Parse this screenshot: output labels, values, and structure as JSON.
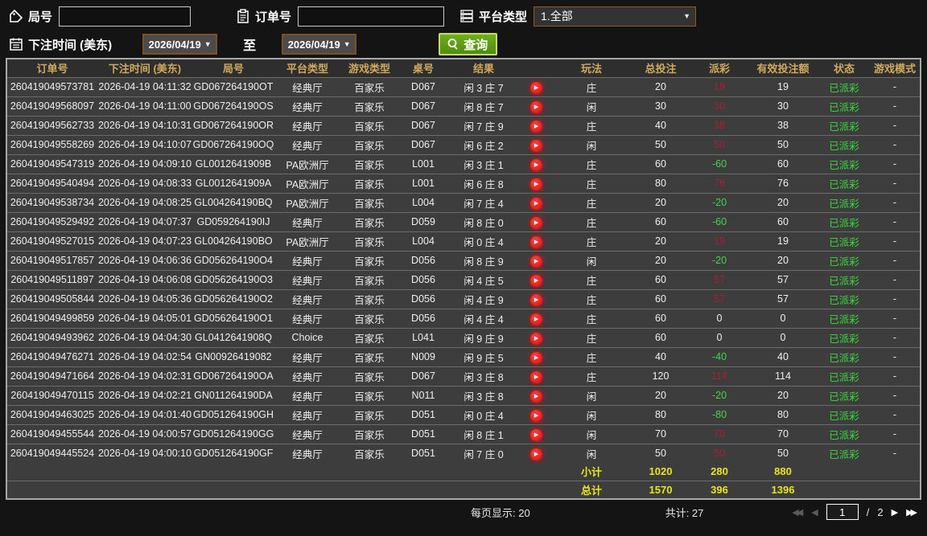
{
  "filters": {
    "game_no_label": "局号",
    "order_no_label": "订单号",
    "platform_label": "平台类型",
    "platform_value": "1.全部",
    "bet_time_label": "下注时间 (美东)",
    "date_from": "2026/04/19",
    "date_to": "2026/04/19",
    "to_label": "至",
    "query_label": "查询",
    "game_no_value": "",
    "order_no_value": ""
  },
  "icons": {
    "dropdown_arrow": "▼",
    "play": "▶",
    "page_first": "◀◀",
    "page_prev": "◀",
    "page_next": "▶",
    "page_last": "▶▶"
  },
  "table": {
    "columns": [
      "订单号",
      "下注时间 (美东)",
      "局号",
      "平台类型",
      "游戏类型",
      "桌号",
      "结果",
      "",
      "玩法",
      "总投注",
      "派彩",
      "有效投注额",
      "状态",
      "游戏模式"
    ],
    "rows": [
      {
        "order": "260419049573781",
        "time": "2026-04-19 04:11:32",
        "round": "GD067264190OT",
        "hall": "经典厅",
        "game": "百家乐",
        "table": "D067",
        "result": "闲 3 庄 7",
        "bet": "庄",
        "stake": "20",
        "payout": "19",
        "valid": "19",
        "status": "已派彩",
        "mode": "-"
      },
      {
        "order": "260419049568097",
        "time": "2026-04-19 04:11:00",
        "round": "GD067264190OS",
        "hall": "经典厅",
        "game": "百家乐",
        "table": "D067",
        "result": "闲 8 庄 7",
        "bet": "闲",
        "stake": "30",
        "payout": "30",
        "valid": "30",
        "status": "已派彩",
        "mode": "-"
      },
      {
        "order": "260419049562733",
        "time": "2026-04-19 04:10:31",
        "round": "GD067264190OR",
        "hall": "经典厅",
        "game": "百家乐",
        "table": "D067",
        "result": "闲 7 庄 9",
        "bet": "庄",
        "stake": "40",
        "payout": "38",
        "valid": "38",
        "status": "已派彩",
        "mode": "-"
      },
      {
        "order": "260419049558269",
        "time": "2026-04-19 04:10:07",
        "round": "GD067264190OQ",
        "hall": "经典厅",
        "game": "百家乐",
        "table": "D067",
        "result": "闲 6 庄 2",
        "bet": "闲",
        "stake": "50",
        "payout": "50",
        "valid": "50",
        "status": "已派彩",
        "mode": "-"
      },
      {
        "order": "260419049547319",
        "time": "2026-04-19 04:09:10",
        "round": "GL0012641909B",
        "hall": "PA欧洲厅",
        "game": "百家乐",
        "table": "L001",
        "result": "闲 3 庄 1",
        "bet": "庄",
        "stake": "60",
        "payout": "-60",
        "valid": "60",
        "status": "已派彩",
        "mode": "-"
      },
      {
        "order": "260419049540494",
        "time": "2026-04-19 04:08:33",
        "round": "GL0012641909A",
        "hall": "PA欧洲厅",
        "game": "百家乐",
        "table": "L001",
        "result": "闲 6 庄 8",
        "bet": "庄",
        "stake": "80",
        "payout": "76",
        "valid": "76",
        "status": "已派彩",
        "mode": "-"
      },
      {
        "order": "260419049538734",
        "time": "2026-04-19 04:08:25",
        "round": "GL004264190BQ",
        "hall": "PA欧洲厅",
        "game": "百家乐",
        "table": "L004",
        "result": "闲 7 庄 4",
        "bet": "庄",
        "stake": "20",
        "payout": "-20",
        "valid": "20",
        "status": "已派彩",
        "mode": "-"
      },
      {
        "order": "260419049529492",
        "time": "2026-04-19 04:07:37",
        "round": "GD059264190IJ",
        "hall": "经典厅",
        "game": "百家乐",
        "table": "D059",
        "result": "闲 8 庄 0",
        "bet": "庄",
        "stake": "60",
        "payout": "-60",
        "valid": "60",
        "status": "已派彩",
        "mode": "-"
      },
      {
        "order": "260419049527015",
        "time": "2026-04-19 04:07:23",
        "round": "GL004264190BO",
        "hall": "PA欧洲厅",
        "game": "百家乐",
        "table": "L004",
        "result": "闲 0 庄 4",
        "bet": "庄",
        "stake": "20",
        "payout": "19",
        "valid": "19",
        "status": "已派彩",
        "mode": "-"
      },
      {
        "order": "260419049517857",
        "time": "2026-04-19 04:06:36",
        "round": "GD056264190O4",
        "hall": "经典厅",
        "game": "百家乐",
        "table": "D056",
        "result": "闲 8 庄 9",
        "bet": "闲",
        "stake": "20",
        "payout": "-20",
        "valid": "20",
        "status": "已派彩",
        "mode": "-"
      },
      {
        "order": "260419049511897",
        "time": "2026-04-19 04:06:08",
        "round": "GD056264190O3",
        "hall": "经典厅",
        "game": "百家乐",
        "table": "D056",
        "result": "闲 4 庄 5",
        "bet": "庄",
        "stake": "60",
        "payout": "57",
        "valid": "57",
        "status": "已派彩",
        "mode": "-"
      },
      {
        "order": "260419049505844",
        "time": "2026-04-19 04:05:36",
        "round": "GD056264190O2",
        "hall": "经典厅",
        "game": "百家乐",
        "table": "D056",
        "result": "闲 4 庄 9",
        "bet": "庄",
        "stake": "60",
        "payout": "57",
        "valid": "57",
        "status": "已派彩",
        "mode": "-"
      },
      {
        "order": "260419049499859",
        "time": "2026-04-19 04:05:01",
        "round": "GD056264190O1",
        "hall": "经典厅",
        "game": "百家乐",
        "table": "D056",
        "result": "闲 4 庄 4",
        "bet": "庄",
        "stake": "60",
        "payout": "0",
        "valid": "0",
        "status": "已派彩",
        "mode": "-"
      },
      {
        "order": "260419049493962",
        "time": "2026-04-19 04:04:30",
        "round": "GL0412641908Q",
        "hall": "Choice",
        "game": "百家乐",
        "table": "L041",
        "result": "闲 9 庄 9",
        "bet": "庄",
        "stake": "60",
        "payout": "0",
        "valid": "0",
        "status": "已派彩",
        "mode": "-"
      },
      {
        "order": "260419049476271",
        "time": "2026-04-19 04:02:54",
        "round": "GN00926419082",
        "hall": "经典厅",
        "game": "百家乐",
        "table": "N009",
        "result": "闲 9 庄 5",
        "bet": "庄",
        "stake": "40",
        "payout": "-40",
        "valid": "40",
        "status": "已派彩",
        "mode": "-"
      },
      {
        "order": "260419049471664",
        "time": "2026-04-19 04:02:31",
        "round": "GD067264190OA",
        "hall": "经典厅",
        "game": "百家乐",
        "table": "D067",
        "result": "闲 3 庄 8",
        "bet": "庄",
        "stake": "120",
        "payout": "114",
        "valid": "114",
        "status": "已派彩",
        "mode": "-"
      },
      {
        "order": "260419049470115",
        "time": "2026-04-19 04:02:21",
        "round": "GN011264190DA",
        "hall": "经典厅",
        "game": "百家乐",
        "table": "N011",
        "result": "闲 3 庄 8",
        "bet": "闲",
        "stake": "20",
        "payout": "-20",
        "valid": "20",
        "status": "已派彩",
        "mode": "-"
      },
      {
        "order": "260419049463025",
        "time": "2026-04-19 04:01:40",
        "round": "GD051264190GH",
        "hall": "经典厅",
        "game": "百家乐",
        "table": "D051",
        "result": "闲 0 庄 4",
        "bet": "闲",
        "stake": "80",
        "payout": "-80",
        "valid": "80",
        "status": "已派彩",
        "mode": "-"
      },
      {
        "order": "260419049455544",
        "time": "2026-04-19 04:00:57",
        "round": "GD051264190GG",
        "hall": "经典厅",
        "game": "百家乐",
        "table": "D051",
        "result": "闲 8 庄 1",
        "bet": "闲",
        "stake": "70",
        "payout": "70",
        "valid": "70",
        "status": "已派彩",
        "mode": "-"
      },
      {
        "order": "260419049445524",
        "time": "2026-04-19 04:00:10",
        "round": "GD051264190GF",
        "hall": "经典厅",
        "game": "百家乐",
        "table": "D051",
        "result": "闲 7 庄 0",
        "bet": "闲",
        "stake": "50",
        "payout": "50",
        "valid": "50",
        "status": "已派彩",
        "mode": "-"
      }
    ]
  },
  "summary": {
    "subtotal_label": "小计",
    "subtotal_values": [
      "1020",
      "280",
      "880"
    ],
    "total_label": "总计",
    "total_values": [
      "1570",
      "396",
      "1396"
    ]
  },
  "footer": {
    "per_page_text": "每页显示: 20",
    "grand_total_text": "共计: 27",
    "current_page": "1",
    "page_separator": "/",
    "total_pages": "2"
  },
  "colors": {
    "header_gold": "#d0a95c",
    "payout_win_red": "#a81f36",
    "payout_loss_green": "#44d644",
    "status_green": "#3adb3a",
    "summary_yellow": "#e6e620",
    "query_button_green": "#5a9c15",
    "date_border_brown": "#7d4f21"
  }
}
